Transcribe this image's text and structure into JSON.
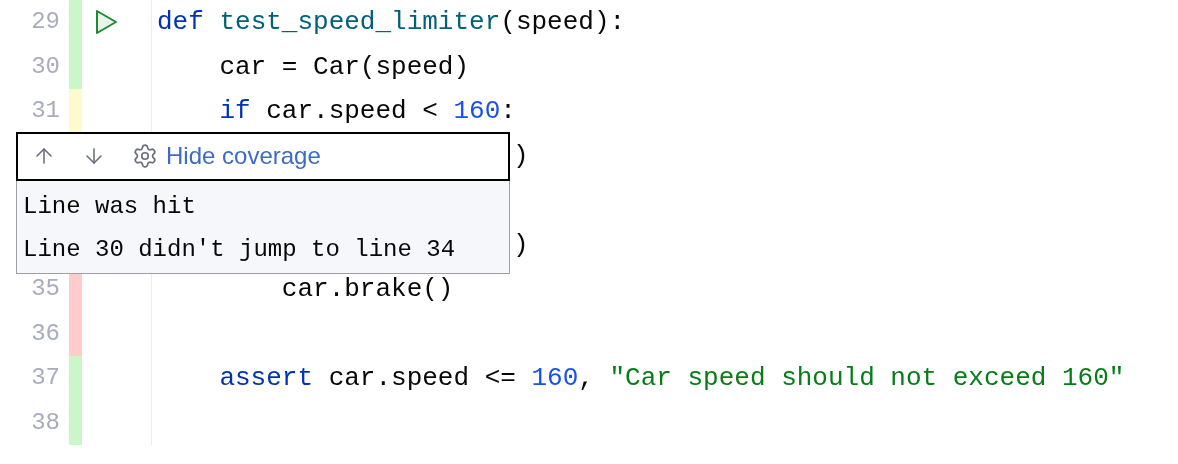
{
  "lines_above": [
    {
      "number": "29",
      "color": "#c9f7c9",
      "run": true,
      "tokens": [
        {
          "kind": "keyword",
          "text": "def "
        },
        {
          "kind": "function",
          "text": "test_speed_limiter"
        },
        {
          "kind": "plain",
          "text": "(speed):"
        }
      ]
    },
    {
      "number": "30",
      "color": "#c9f7c9",
      "run": false,
      "tokens": [
        {
          "kind": "plain",
          "text": "    car = Car(speed)"
        }
      ]
    },
    {
      "number": "31",
      "color": "#fdfbcb",
      "run": false,
      "tokens": [
        {
          "kind": "keyword",
          "text": "    if"
        },
        {
          "kind": "plain",
          "text": " car.speed < "
        },
        {
          "kind": "number",
          "text": "160"
        },
        {
          "kind": "plain",
          "text": ":"
        }
      ]
    }
  ],
  "popup": {
    "link": "Hide coverage",
    "messages": [
      "Line was hit",
      "Line 30 didn't jump to line 34"
    ],
    "code_beside": [
      ")",
      ")"
    ]
  },
  "lines_below": [
    {
      "number": "35",
      "color": "#ffcccb",
      "run": false,
      "tokens": [
        {
          "kind": "plain",
          "text": "        car.brake()"
        }
      ]
    },
    {
      "number": "36",
      "color": "#ffcccb",
      "run": false
    },
    {
      "number": "37",
      "color": "#c9f7c9",
      "run": false,
      "tokens": [
        {
          "kind": "keyword",
          "text": "    assert"
        },
        {
          "kind": "plain",
          "text": " car.speed <= "
        },
        {
          "kind": "number",
          "text": "160"
        },
        {
          "kind": "plain",
          "text": ", "
        },
        {
          "kind": "string",
          "text": "\"Car speed should not exceed 160\""
        }
      ]
    },
    {
      "number": "38",
      "color": "#c9f7c9",
      "run": false
    }
  ]
}
